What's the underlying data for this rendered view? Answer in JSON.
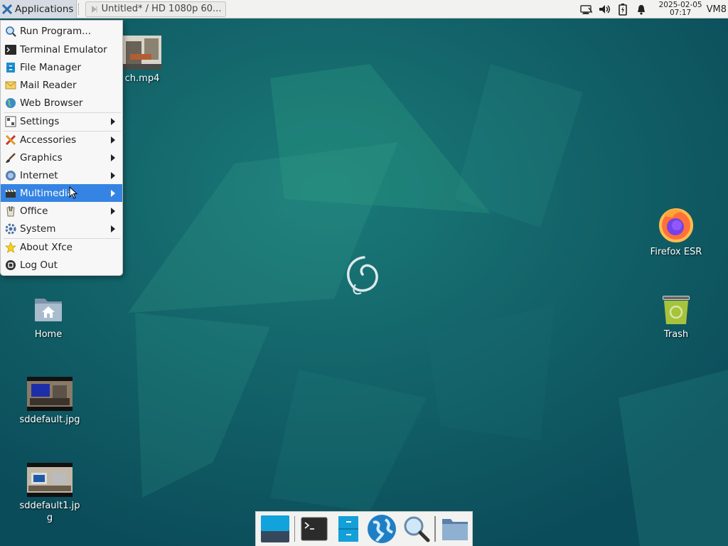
{
  "panel": {
    "applications_label": "Applications",
    "task_title": "Untitled* / HD 1080p 60...",
    "clock_date": "2025-02-05",
    "clock_time": "07:17",
    "vm_label": "VM8"
  },
  "menu": {
    "items": [
      {
        "label": "Run Program...",
        "icon": "search-icon"
      },
      {
        "label": "Terminal Emulator",
        "icon": "terminal-icon"
      },
      {
        "label": "File Manager",
        "icon": "file-manager-icon"
      },
      {
        "label": "Mail Reader",
        "icon": "mail-icon"
      },
      {
        "label": "Web Browser",
        "icon": "globe-icon"
      },
      {
        "label": "Settings",
        "icon": "settings-icon",
        "submenu": true
      },
      {
        "label": "Accessories",
        "icon": "accessories-icon",
        "submenu": true
      },
      {
        "label": "Graphics",
        "icon": "brush-icon",
        "submenu": true
      },
      {
        "label": "Internet",
        "icon": "globe-icon",
        "submenu": true
      },
      {
        "label": "Multimedia",
        "icon": "multimedia-icon",
        "submenu": true,
        "active": true
      },
      {
        "label": "Office",
        "icon": "office-icon",
        "submenu": true
      },
      {
        "label": "System",
        "icon": "gear-icon",
        "submenu": true
      },
      {
        "label": "About Xfce",
        "icon": "star-icon"
      },
      {
        "label": "Log Out",
        "icon": "logout-icon"
      }
    ]
  },
  "desktop": {
    "icons": [
      {
        "label": "ch.mp4",
        "icon": "video-thumbnail-icon"
      },
      {
        "label": "Firefox ESR",
        "icon": "firefox-icon"
      },
      {
        "label": "Home",
        "icon": "home-folder-icon"
      },
      {
        "label": "Trash",
        "icon": "trash-icon"
      },
      {
        "label": "sddefault.jpg",
        "icon": "image-thumbnail-icon"
      },
      {
        "label": "sddefault1.jp",
        "label2": "g",
        "icon": "image-thumbnail-icon"
      }
    ]
  },
  "dock": {
    "items": [
      {
        "icon": "show-desktop-icon"
      },
      {
        "icon": "terminal-icon"
      },
      {
        "icon": "file-manager-icon"
      },
      {
        "icon": "web-browser-icon"
      },
      {
        "icon": "app-finder-icon"
      },
      {
        "icon": "folder-icon"
      }
    ]
  },
  "colors": {
    "accent": "#3584e4",
    "desktop_bg": "#0f5a66",
    "panel_bg": "#f2f2f0"
  }
}
